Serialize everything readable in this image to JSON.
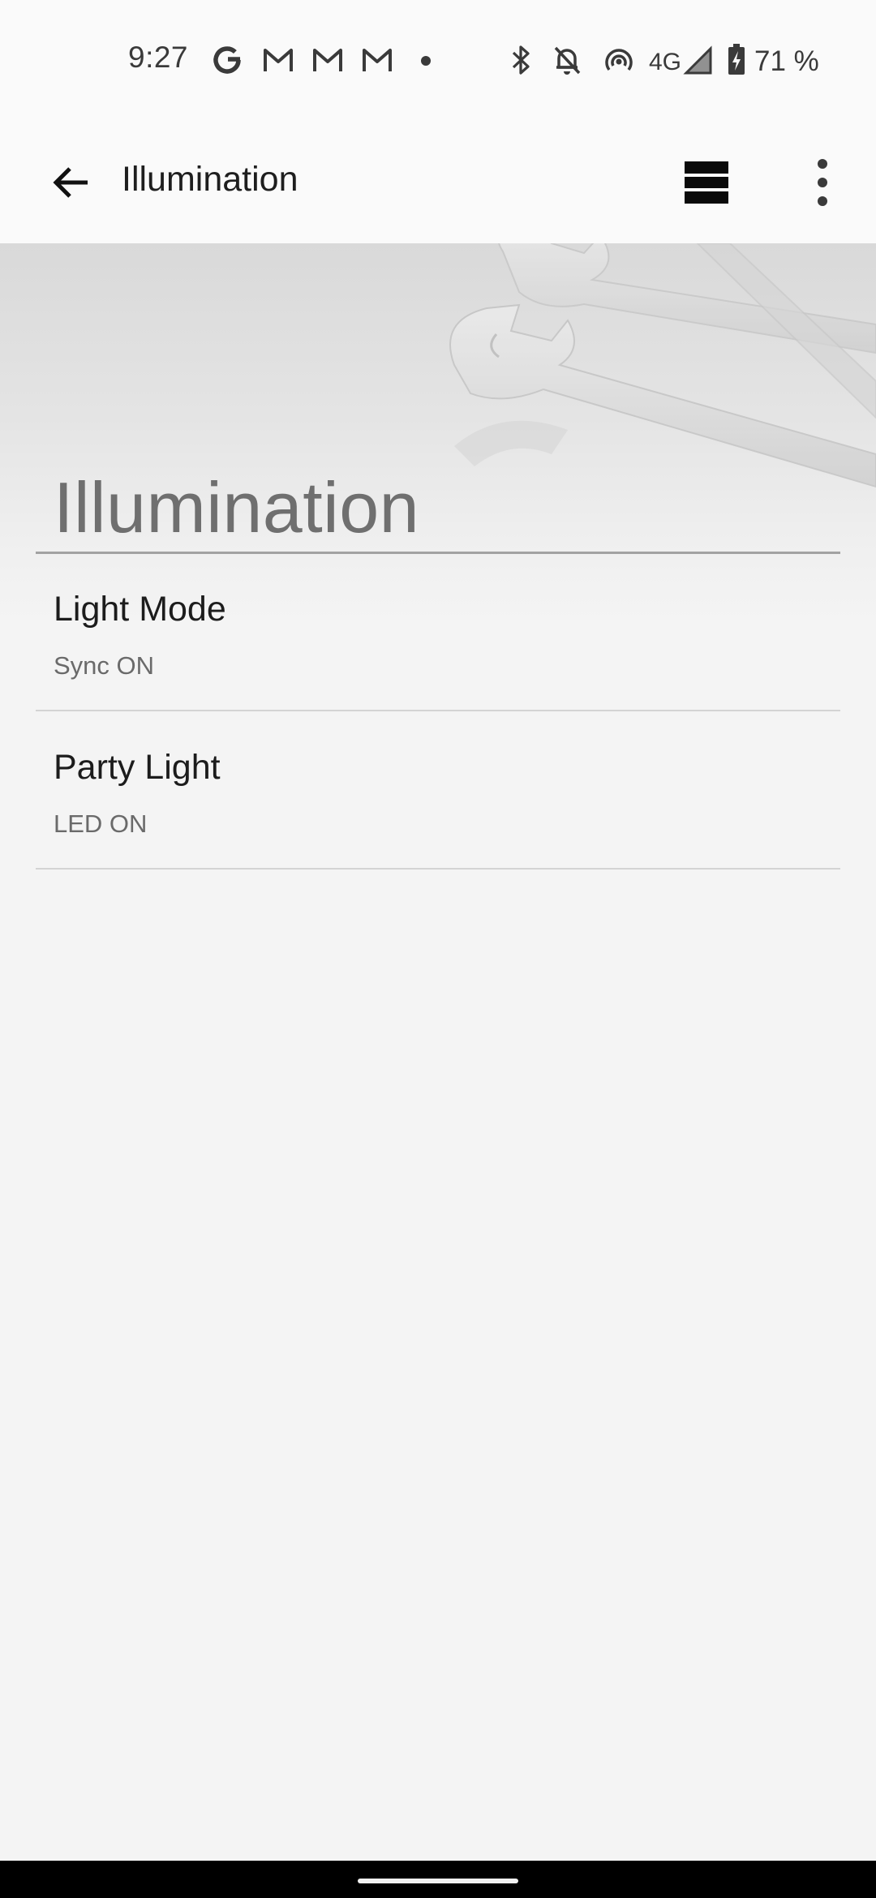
{
  "status_bar": {
    "time": "9:27",
    "notification_icons": [
      "google-g-icon",
      "gmail-icon",
      "gmail-icon",
      "gmail-icon",
      "dot-icon"
    ],
    "system_icons": [
      "bluetooth-icon",
      "notifications-off-icon",
      "hotspot-icon",
      "4g-icon",
      "signal-icon",
      "battery-charging-icon"
    ],
    "network_label": "4G",
    "battery": "71 %"
  },
  "app_bar": {
    "title": "Illumination",
    "icons": [
      "back-arrow-icon",
      "view-list-icon",
      "more-vert-icon"
    ]
  },
  "hero": {
    "section_title": "Illumination",
    "background_art": "wrench-icon"
  },
  "items": [
    {
      "label": "Light Mode",
      "value": "Sync ON"
    },
    {
      "label": "Party Light",
      "value": "LED ON"
    }
  ],
  "colors": {
    "background": "#f4f4f4",
    "app_bar": "#fafafa",
    "primary_text": "#1c1c1c",
    "secondary_text": "#6a6a6a",
    "divider": "#d3d3d3",
    "nav_bar": "#000000"
  }
}
